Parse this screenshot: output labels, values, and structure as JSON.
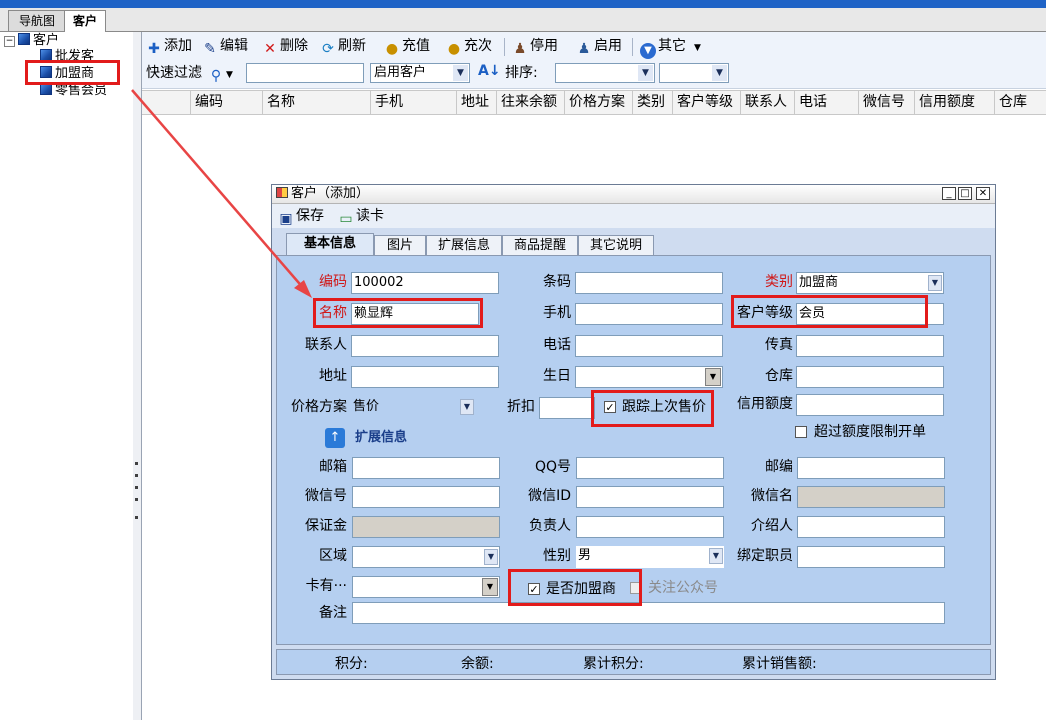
{
  "app_tabs": [
    {
      "label": "导航图"
    },
    {
      "label": "客户"
    }
  ],
  "tree": {
    "root": "客户",
    "children": [
      "批发客",
      "加盟商",
      "零售会员"
    ]
  },
  "toolbar": {
    "add": "添加",
    "edit": "编辑",
    "delete": "删除",
    "refresh": "刷新",
    "recharge": "充值",
    "recharge_times": "充次",
    "disable": "停用",
    "enable": "启用",
    "other": "其它"
  },
  "filterbar": {
    "quick_filter_label": "快速过滤",
    "filter_value": "",
    "status_select": "启用客户",
    "sort_label": "排序:",
    "sort_select_1": "",
    "sort_select_2": ""
  },
  "grid_columns": [
    "编码",
    "名称",
    "手机",
    "地址",
    "往来余额",
    "价格方案",
    "类别",
    "客户等级",
    "联系人",
    "电话",
    "微信号",
    "信用额度",
    "仓库"
  ],
  "dialog": {
    "title": "客户（添加）",
    "save": "保存",
    "read_card": "读卡",
    "tabs": [
      "基本信息",
      "图片",
      "扩展信息",
      "商品提醒",
      "其它说明"
    ],
    "fields": {
      "code_label": "编码",
      "code_value": "100002",
      "barcode_label": "条码",
      "barcode_value": "",
      "category_label": "类别",
      "category_value": "加盟商",
      "name_label": "名称",
      "name_value": "赖显辉",
      "mobile_label": "手机",
      "mobile_value": "",
      "level_label": "客户等级",
      "level_value": "会员",
      "contact_label": "联系人",
      "contact_value": "",
      "phone_label": "电话",
      "phone_value": "",
      "fax_label": "传真",
      "fax_value": "",
      "address_label": "地址",
      "address_value": "",
      "birthday_label": "生日",
      "birthday_value": "",
      "warehouse_label": "仓库",
      "warehouse_value": "",
      "price_plan_label": "价格方案",
      "price_plan_value": "售价",
      "discount_label": "折扣",
      "discount_value": "",
      "track_last_price_label": "跟踪上次售价",
      "credit_label": "信用额度",
      "credit_value": "",
      "over_credit_label": "超过额度限制开单",
      "ext_section": "扩展信息",
      "email_label": "邮箱",
      "email_value": "",
      "qq_label": "QQ号",
      "qq_value": "",
      "postcode_label": "邮编",
      "postcode_value": "",
      "wechat_label": "微信号",
      "wechat_value": "",
      "wechat_id_label": "微信ID",
      "wechat_id_value": "",
      "wechat_name_label": "微信名",
      "wechat_name_value": "",
      "deposit_label": "保证金",
      "deposit_value": "",
      "owner_label": "负责人",
      "owner_value": "",
      "referrer_label": "介绍人",
      "referrer_value": "",
      "region_label": "区域",
      "region_value": "",
      "gender_label": "性别",
      "gender_value": "男",
      "bind_staff_label": "绑定职员",
      "bind_staff_value": "",
      "card_label": "卡有···",
      "card_value": "",
      "is_franchise_label": "是否加盟商",
      "follow_label": "关注公众号",
      "remark_label": "备注",
      "remark_value": ""
    },
    "checkboxes": {
      "track_last_price": true,
      "over_credit": false,
      "is_franchise": true,
      "follow": false
    },
    "status": {
      "points": "积分:",
      "balance": "余额:",
      "total_points": "累计积分:",
      "total_sales": "累计销售额:"
    }
  },
  "colors": {
    "annotation": "#e21b1b",
    "title_bar": "#1f63c6",
    "panel": "#b5cff0"
  }
}
